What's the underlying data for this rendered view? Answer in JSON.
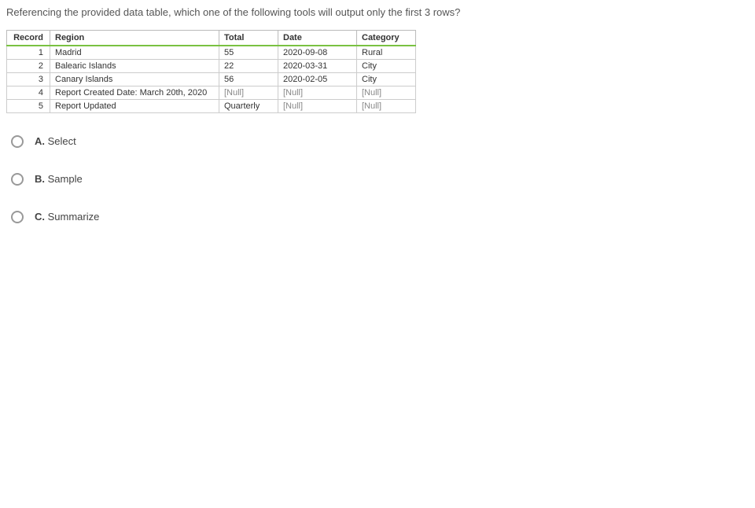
{
  "question": "Referencing the provided data table, which one of the following tools will output only the first 3 rows?",
  "table": {
    "headers": {
      "record": "Record",
      "region": "Region",
      "total": "Total",
      "date": "Date",
      "category": "Category"
    },
    "rows": [
      {
        "record": "1",
        "region": "Madrid",
        "total": "55",
        "date": "2020-09-08",
        "category": "Rural"
      },
      {
        "record": "2",
        "region": "Balearic Islands",
        "total": "22",
        "date": "2020-03-31",
        "category": "City"
      },
      {
        "record": "3",
        "region": "Canary Islands",
        "total": "56",
        "date": "2020-02-05",
        "category": "City"
      },
      {
        "record": "4",
        "region": "Report Created Date: March 20th, 2020",
        "total": "[Null]",
        "date": "[Null]",
        "category": "[Null]"
      },
      {
        "record": "5",
        "region": "Report Updated",
        "total": "Quarterly",
        "date": "[Null]",
        "category": "[Null]"
      }
    ]
  },
  "options": [
    {
      "letter": "A.",
      "text": "Select"
    },
    {
      "letter": "B.",
      "text": "Sample"
    },
    {
      "letter": "C.",
      "text": "Summarize"
    }
  ]
}
